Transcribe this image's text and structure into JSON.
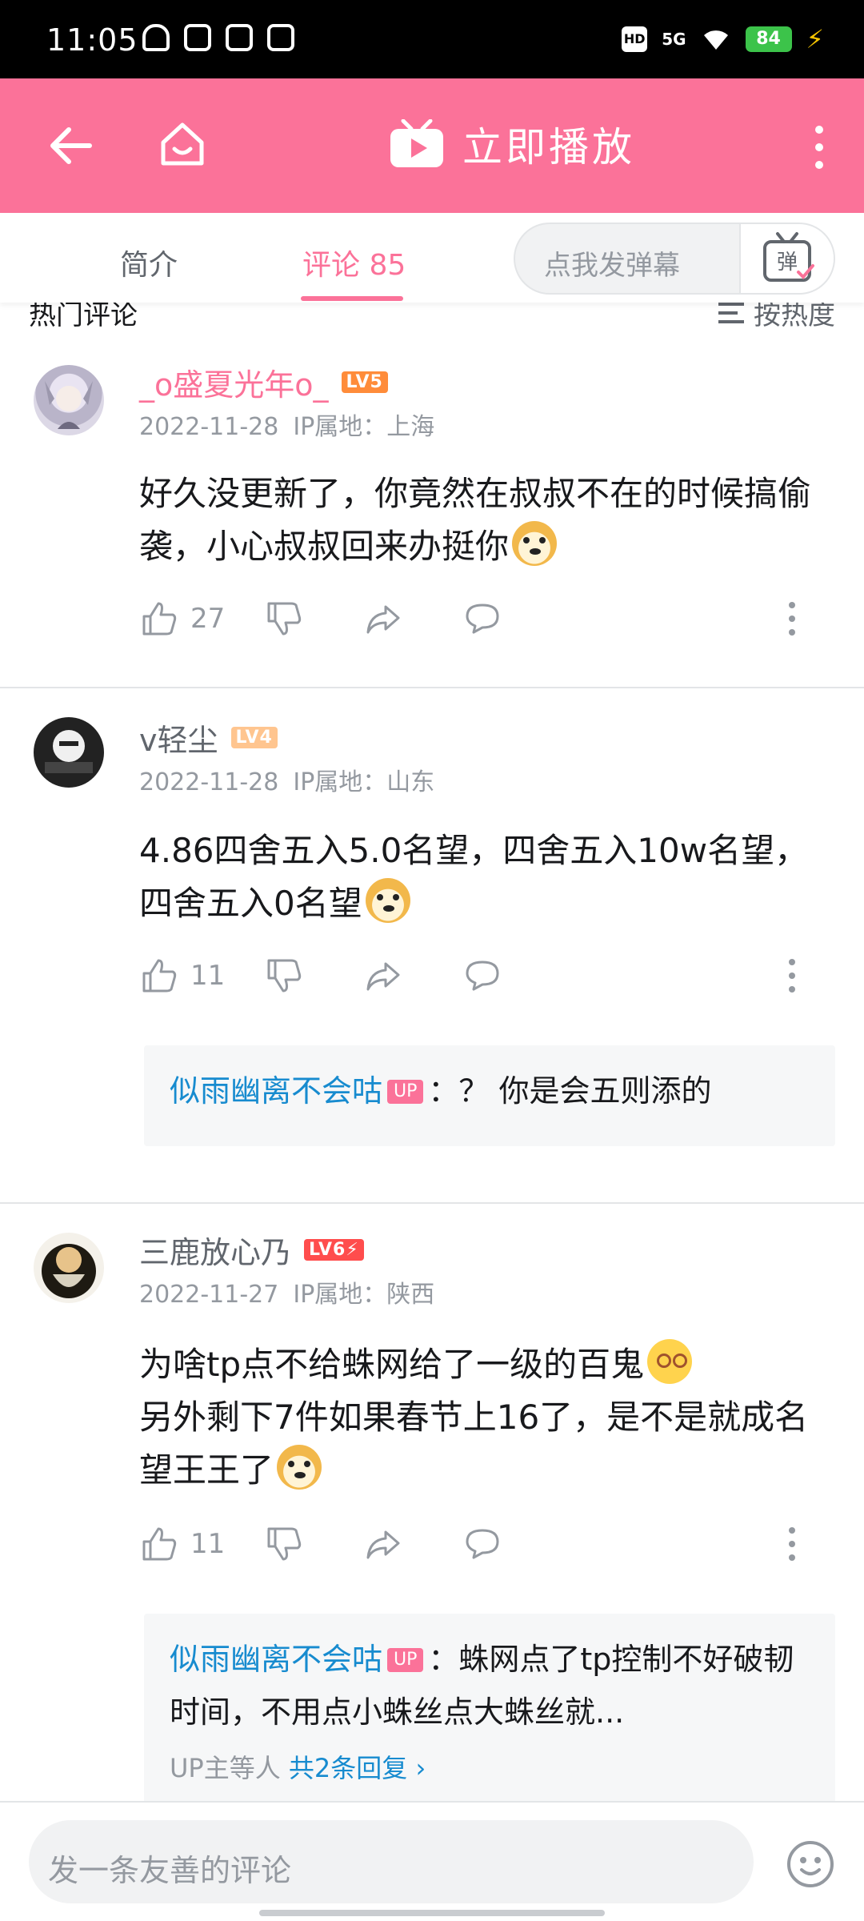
{
  "status_bar": {
    "time": "11:05",
    "network": "5G",
    "hd_label": "HD",
    "battery": "84",
    "icons": [
      "qq-icon",
      "play-icon",
      "video-icon",
      "pay-icon",
      "wifi-icon",
      "charging-icon"
    ]
  },
  "header": {
    "play_label": "立即播放",
    "background": "#fb7299"
  },
  "tabs": {
    "intro": "简介",
    "comments": "评论 85",
    "danmaku_placeholder": "点我发弹幕",
    "danmaku_button": "弹"
  },
  "sort": {
    "title": "热门评论",
    "button": "按热度"
  },
  "comments": [
    {
      "username": "_o盛夏光年o_",
      "level": "LV5",
      "level_color": "#ff6699",
      "username_color": "#fb7299",
      "date": "2022-11-28",
      "location": "IP属地：上海",
      "text": "好久没更新了，你竟然在叔叔不在的时候搞偷袭，小心叔叔回来办挺你",
      "likes": "27"
    },
    {
      "username": "v轻尘",
      "level": "LV4",
      "level_color": "#ffb37c",
      "date": "2022-11-28",
      "location": "IP属地：山东",
      "text": "4.86四舍五入5.0名望，四舍五入10w名望，四舍五入0名望",
      "likes": "11",
      "reply": {
        "user": "似雨幽离不会咕",
        "badge": "UP",
        "text": "：？ 你是会五则添的"
      }
    },
    {
      "username": "三鹿放心乃",
      "level": "LV6⚡",
      "level_color": "#ff4d4d",
      "date": "2022-11-27",
      "location": "IP属地：陕西",
      "text_line1": "为啥tp点不给蛛网给了一级的百鬼",
      "text_line2": "另外剩下7件如果春节上16了，是不是就成名望王王了",
      "likes": "11",
      "reply": {
        "user": "似雨幽离不会咕",
        "badge": "UP",
        "text": "：蛛网点了tp控制不好破韧时间，不用点小蛛丝点大蛛丝就...",
        "more_prefix": "UP主等人",
        "more_link": "共2条回复"
      }
    }
  ],
  "bottom": {
    "placeholder": "发一条友善的评论"
  }
}
